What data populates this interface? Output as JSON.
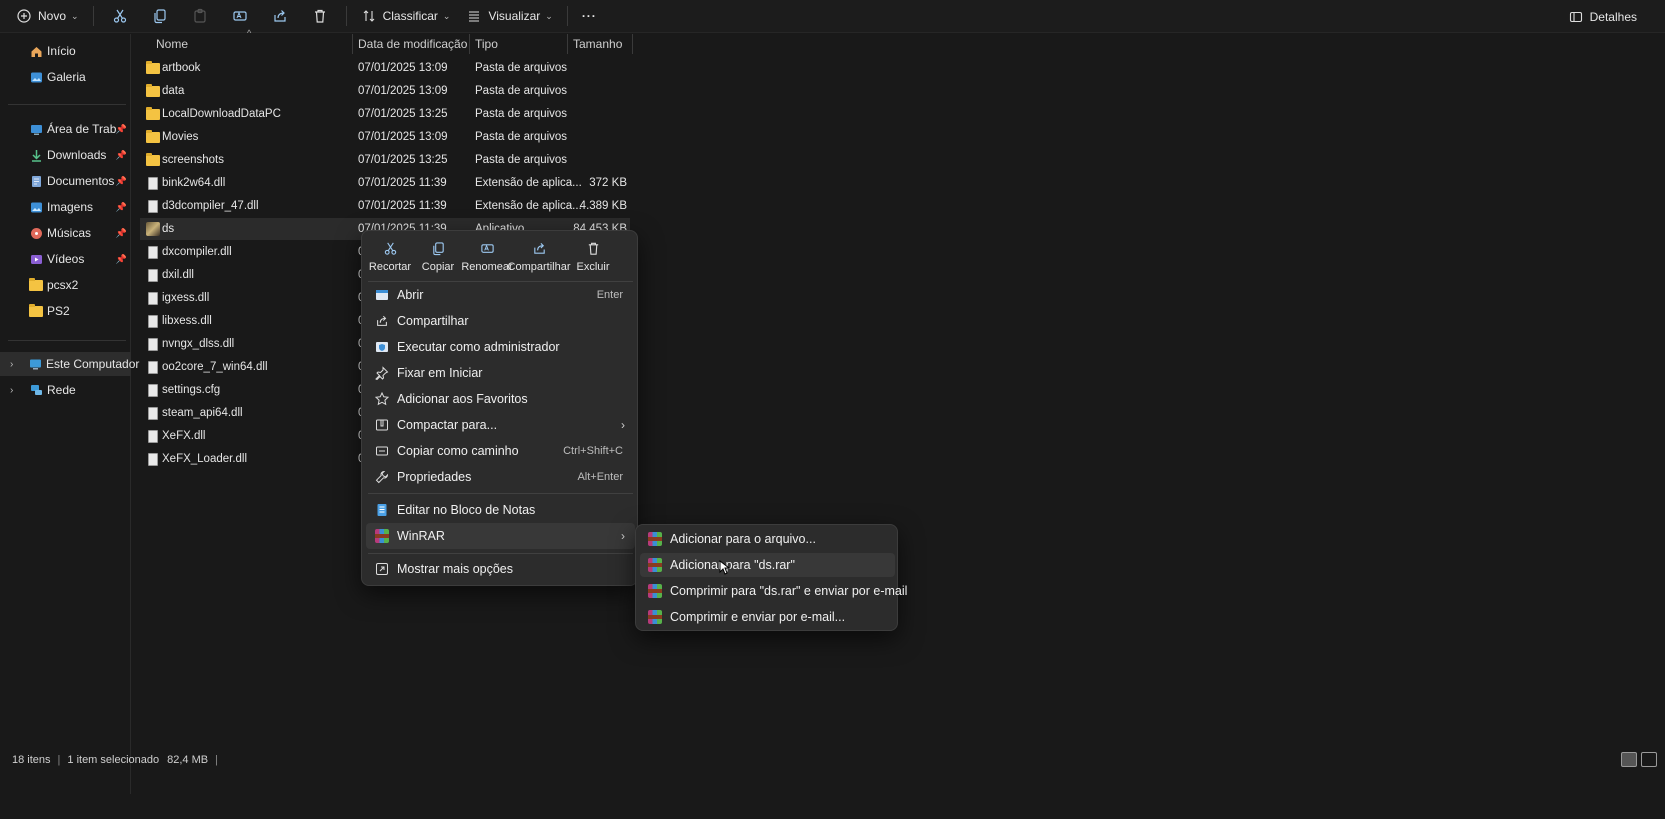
{
  "toolbar": {
    "new_label": "Novo",
    "sort_label": "Classificar",
    "view_label": "Visualizar",
    "more_label": "···",
    "details_label": "Detalhes",
    "icons": [
      "cut-icon",
      "copy-icon",
      "paste-icon",
      "rename-icon",
      "share-icon",
      "delete-icon"
    ]
  },
  "sidebar": {
    "items": [
      {
        "label": "Início",
        "icon": "home-icon"
      },
      {
        "label": "Galeria",
        "icon": "gallery-icon"
      },
      {
        "label": "Área de Trabalho",
        "icon": "desktop-icon",
        "pinned": true
      },
      {
        "label": "Downloads",
        "icon": "download-icon",
        "pinned": true
      },
      {
        "label": "Documentos",
        "icon": "documents-icon",
        "pinned": true
      },
      {
        "label": "Imagens",
        "icon": "pictures-icon",
        "pinned": true
      },
      {
        "label": "Músicas",
        "icon": "music-icon",
        "pinned": true
      },
      {
        "label": "Vídeos",
        "icon": "videos-icon",
        "pinned": true
      },
      {
        "label": "pcsx2",
        "icon": "folder-icon"
      },
      {
        "label": "PS2",
        "icon": "folder-icon"
      },
      {
        "label": "Este Computador",
        "icon": "computer-icon"
      },
      {
        "label": "Rede",
        "icon": "network-icon"
      }
    ]
  },
  "columns": {
    "name": "Nome",
    "date": "Data de modificação",
    "type": "Tipo",
    "size": "Tamanho"
  },
  "files": [
    {
      "name": "artbook",
      "date": "07/01/2025 13:09",
      "type": "Pasta de arquivos",
      "size": "",
      "kind": "folder"
    },
    {
      "name": "data",
      "date": "07/01/2025 13:09",
      "type": "Pasta de arquivos",
      "size": "",
      "kind": "folder"
    },
    {
      "name": "LocalDownloadDataPC",
      "date": "07/01/2025 13:25",
      "type": "Pasta de arquivos",
      "size": "",
      "kind": "folder"
    },
    {
      "name": "Movies",
      "date": "07/01/2025 13:09",
      "type": "Pasta de arquivos",
      "size": "",
      "kind": "folder"
    },
    {
      "name": "screenshots",
      "date": "07/01/2025 13:25",
      "type": "Pasta de arquivos",
      "size": "",
      "kind": "folder"
    },
    {
      "name": "bink2w64.dll",
      "date": "07/01/2025 11:39",
      "type": "Extensão de aplica...",
      "size": "372 KB",
      "kind": "file"
    },
    {
      "name": "d3dcompiler_47.dll",
      "date": "07/01/2025 11:39",
      "type": "Extensão de aplica...",
      "size": "4.389 KB",
      "kind": "file"
    },
    {
      "name": "ds",
      "date": "07/01/2025 11:39",
      "type": "Aplicativo",
      "size": "84.453 KB",
      "kind": "app"
    },
    {
      "name": "dxcompiler.dll",
      "date": "0",
      "type": "",
      "size": "",
      "kind": "file"
    },
    {
      "name": "dxil.dll",
      "date": "0",
      "type": "",
      "size": "",
      "kind": "file"
    },
    {
      "name": "igxess.dll",
      "date": "0",
      "type": "",
      "size": "",
      "kind": "file"
    },
    {
      "name": "libxess.dll",
      "date": "0",
      "type": "",
      "size": "",
      "kind": "file"
    },
    {
      "name": "nvngx_dlss.dll",
      "date": "0",
      "type": "",
      "size": "",
      "kind": "file"
    },
    {
      "name": "oo2core_7_win64.dll",
      "date": "0",
      "type": "",
      "size": "",
      "kind": "file"
    },
    {
      "name": "settings.cfg",
      "date": "0",
      "type": "",
      "size": "",
      "kind": "file"
    },
    {
      "name": "steam_api64.dll",
      "date": "0",
      "type": "",
      "size": "",
      "kind": "file"
    },
    {
      "name": "XeFX.dll",
      "date": "0",
      "type": "",
      "size": "",
      "kind": "file"
    },
    {
      "name": "XeFX_Loader.dll",
      "date": "0",
      "type": "",
      "size": "",
      "kind": "file"
    }
  ],
  "context_menu": {
    "quick_actions": [
      {
        "label": "Recortar",
        "icon": "cut-icon"
      },
      {
        "label": "Copiar",
        "icon": "copy-icon"
      },
      {
        "label": "Renomear",
        "icon": "rename-icon"
      },
      {
        "label": "Compartilhar",
        "icon": "share-icon"
      },
      {
        "label": "Excluir",
        "icon": "delete-icon"
      }
    ],
    "items": [
      {
        "label": "Abrir",
        "shortcut": "Enter",
        "icon": "open-icon"
      },
      {
        "label": "Compartilhar",
        "shortcut": "",
        "icon": "share-icon"
      },
      {
        "label": "Executar como administrador",
        "shortcut": "",
        "icon": "shield-icon"
      },
      {
        "label": "Fixar em Iniciar",
        "shortcut": "",
        "icon": "pin-icon"
      },
      {
        "label": "Adicionar aos Favoritos",
        "shortcut": "",
        "icon": "star-icon"
      },
      {
        "label": "Compactar para...",
        "shortcut": "",
        "icon": "zip-icon",
        "submenu": true
      },
      {
        "label": "Copiar como caminho",
        "shortcut": "Ctrl+Shift+C",
        "icon": "path-icon"
      },
      {
        "label": "Propriedades",
        "shortcut": "Alt+Enter",
        "icon": "wrench-icon"
      },
      {
        "label": "Editar no Bloco de Notas",
        "shortcut": "",
        "icon": "notepad-icon"
      },
      {
        "label": "WinRAR",
        "shortcut": "",
        "icon": "winrar-icon",
        "submenu": true
      },
      {
        "label": "Mostrar mais opções",
        "shortcut": "",
        "icon": "more-options-icon"
      }
    ]
  },
  "winrar_submenu": {
    "items": [
      {
        "label": "Adicionar para o arquivo..."
      },
      {
        "label": "Adicionar para \"ds.rar\""
      },
      {
        "label": "Comprimir para \"ds.rar\" e enviar por e-mail"
      },
      {
        "label": "Comprimir e enviar por e-mail..."
      }
    ]
  },
  "status": {
    "count": "18 itens",
    "selected": "1 item selecionado",
    "size": "82,4 MB"
  }
}
